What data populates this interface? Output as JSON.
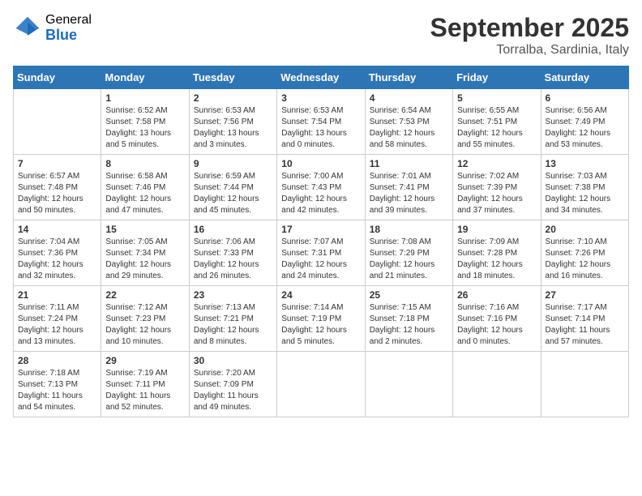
{
  "header": {
    "logo_general": "General",
    "logo_blue": "Blue",
    "month_title": "September 2025",
    "location": "Torralba, Sardinia, Italy"
  },
  "weekdays": [
    "Sunday",
    "Monday",
    "Tuesday",
    "Wednesday",
    "Thursday",
    "Friday",
    "Saturday"
  ],
  "weeks": [
    [
      {
        "day": "",
        "text": ""
      },
      {
        "day": "1",
        "text": "Sunrise: 6:52 AM\nSunset: 7:58 PM\nDaylight: 13 hours\nand 5 minutes."
      },
      {
        "day": "2",
        "text": "Sunrise: 6:53 AM\nSunset: 7:56 PM\nDaylight: 13 hours\nand 3 minutes."
      },
      {
        "day": "3",
        "text": "Sunrise: 6:53 AM\nSunset: 7:54 PM\nDaylight: 13 hours\nand 0 minutes."
      },
      {
        "day": "4",
        "text": "Sunrise: 6:54 AM\nSunset: 7:53 PM\nDaylight: 12 hours\nand 58 minutes."
      },
      {
        "day": "5",
        "text": "Sunrise: 6:55 AM\nSunset: 7:51 PM\nDaylight: 12 hours\nand 55 minutes."
      },
      {
        "day": "6",
        "text": "Sunrise: 6:56 AM\nSunset: 7:49 PM\nDaylight: 12 hours\nand 53 minutes."
      }
    ],
    [
      {
        "day": "7",
        "text": "Sunrise: 6:57 AM\nSunset: 7:48 PM\nDaylight: 12 hours\nand 50 minutes."
      },
      {
        "day": "8",
        "text": "Sunrise: 6:58 AM\nSunset: 7:46 PM\nDaylight: 12 hours\nand 47 minutes."
      },
      {
        "day": "9",
        "text": "Sunrise: 6:59 AM\nSunset: 7:44 PM\nDaylight: 12 hours\nand 45 minutes."
      },
      {
        "day": "10",
        "text": "Sunrise: 7:00 AM\nSunset: 7:43 PM\nDaylight: 12 hours\nand 42 minutes."
      },
      {
        "day": "11",
        "text": "Sunrise: 7:01 AM\nSunset: 7:41 PM\nDaylight: 12 hours\nand 39 minutes."
      },
      {
        "day": "12",
        "text": "Sunrise: 7:02 AM\nSunset: 7:39 PM\nDaylight: 12 hours\nand 37 minutes."
      },
      {
        "day": "13",
        "text": "Sunrise: 7:03 AM\nSunset: 7:38 PM\nDaylight: 12 hours\nand 34 minutes."
      }
    ],
    [
      {
        "day": "14",
        "text": "Sunrise: 7:04 AM\nSunset: 7:36 PM\nDaylight: 12 hours\nand 32 minutes."
      },
      {
        "day": "15",
        "text": "Sunrise: 7:05 AM\nSunset: 7:34 PM\nDaylight: 12 hours\nand 29 minutes."
      },
      {
        "day": "16",
        "text": "Sunrise: 7:06 AM\nSunset: 7:33 PM\nDaylight: 12 hours\nand 26 minutes."
      },
      {
        "day": "17",
        "text": "Sunrise: 7:07 AM\nSunset: 7:31 PM\nDaylight: 12 hours\nand 24 minutes."
      },
      {
        "day": "18",
        "text": "Sunrise: 7:08 AM\nSunset: 7:29 PM\nDaylight: 12 hours\nand 21 minutes."
      },
      {
        "day": "19",
        "text": "Sunrise: 7:09 AM\nSunset: 7:28 PM\nDaylight: 12 hours\nand 18 minutes."
      },
      {
        "day": "20",
        "text": "Sunrise: 7:10 AM\nSunset: 7:26 PM\nDaylight: 12 hours\nand 16 minutes."
      }
    ],
    [
      {
        "day": "21",
        "text": "Sunrise: 7:11 AM\nSunset: 7:24 PM\nDaylight: 12 hours\nand 13 minutes."
      },
      {
        "day": "22",
        "text": "Sunrise: 7:12 AM\nSunset: 7:23 PM\nDaylight: 12 hours\nand 10 minutes."
      },
      {
        "day": "23",
        "text": "Sunrise: 7:13 AM\nSunset: 7:21 PM\nDaylight: 12 hours\nand 8 minutes."
      },
      {
        "day": "24",
        "text": "Sunrise: 7:14 AM\nSunset: 7:19 PM\nDaylight: 12 hours\nand 5 minutes."
      },
      {
        "day": "25",
        "text": "Sunrise: 7:15 AM\nSunset: 7:18 PM\nDaylight: 12 hours\nand 2 minutes."
      },
      {
        "day": "26",
        "text": "Sunrise: 7:16 AM\nSunset: 7:16 PM\nDaylight: 12 hours\nand 0 minutes."
      },
      {
        "day": "27",
        "text": "Sunrise: 7:17 AM\nSunset: 7:14 PM\nDaylight: 11 hours\nand 57 minutes."
      }
    ],
    [
      {
        "day": "28",
        "text": "Sunrise: 7:18 AM\nSunset: 7:13 PM\nDaylight: 11 hours\nand 54 minutes."
      },
      {
        "day": "29",
        "text": "Sunrise: 7:19 AM\nSunset: 7:11 PM\nDaylight: 11 hours\nand 52 minutes."
      },
      {
        "day": "30",
        "text": "Sunrise: 7:20 AM\nSunset: 7:09 PM\nDaylight: 11 hours\nand 49 minutes."
      },
      {
        "day": "",
        "text": ""
      },
      {
        "day": "",
        "text": ""
      },
      {
        "day": "",
        "text": ""
      },
      {
        "day": "",
        "text": ""
      }
    ]
  ]
}
